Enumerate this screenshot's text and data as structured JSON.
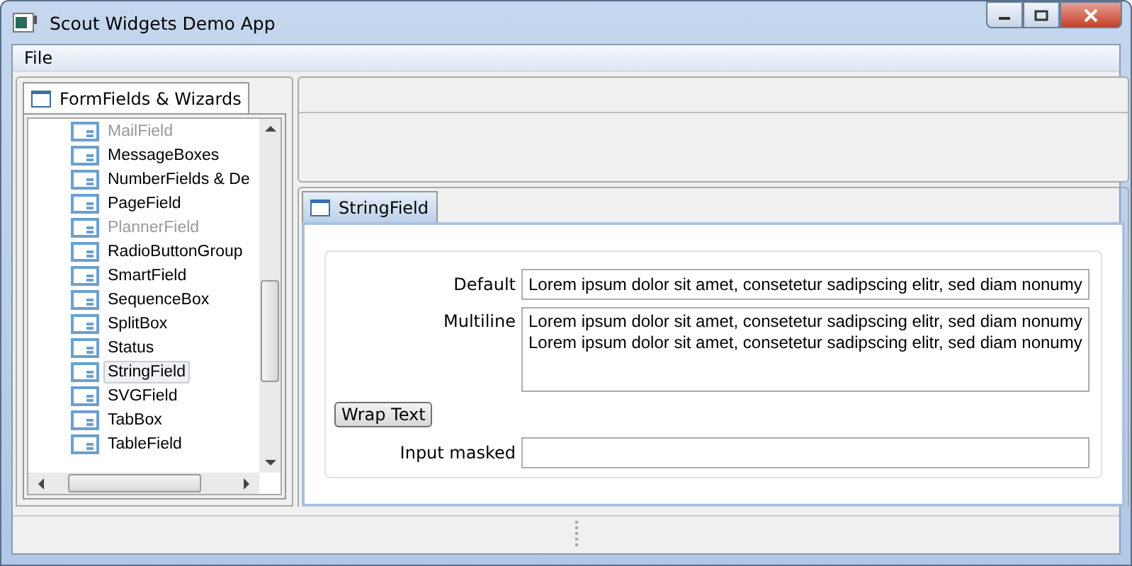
{
  "window": {
    "title": "Scout Widgets Demo App"
  },
  "menu": [
    "File"
  ],
  "left_tab": {
    "label": "FormFields & Wizards",
    "selected": true
  },
  "tree": [
    {
      "label": "MailField",
      "disabled": true,
      "selected": false
    },
    {
      "label": "MessageBoxes",
      "disabled": false,
      "selected": false
    },
    {
      "label": "NumberFields & De",
      "disabled": false,
      "selected": false
    },
    {
      "label": "PageField",
      "disabled": false,
      "selected": false
    },
    {
      "label": "PlannerField",
      "disabled": true,
      "selected": false
    },
    {
      "label": "RadioButtonGroup",
      "disabled": false,
      "selected": false
    },
    {
      "label": "SmartField",
      "disabled": false,
      "selected": false
    },
    {
      "label": "SequenceBox",
      "disabled": false,
      "selected": false
    },
    {
      "label": "SplitBox",
      "disabled": false,
      "selected": false
    },
    {
      "label": "Status",
      "disabled": false,
      "selected": false
    },
    {
      "label": "StringField",
      "disabled": false,
      "selected": true
    },
    {
      "label": "SVGField",
      "disabled": false,
      "selected": false
    },
    {
      "label": "TabBox",
      "disabled": false,
      "selected": false
    },
    {
      "label": "TableField",
      "disabled": false,
      "selected": false
    }
  ],
  "form_tab": {
    "label": "StringField",
    "selected": true
  },
  "fields": [
    {
      "kind": "text",
      "label": "Default",
      "value": "Lorem ipsum dolor sit amet, consetetur sadipscing elitr, sed diam nonumy"
    },
    {
      "kind": "multiline",
      "label": "Multiline",
      "lines": [
        "Lorem ipsum dolor sit amet, consetetur sadipscing elitr, sed diam nonumy",
        "Lorem ipsum dolor sit amet, consetetur sadipscing elitr, sed diam nonumy"
      ]
    },
    {
      "kind": "button",
      "label": "Wrap Text"
    },
    {
      "kind": "text",
      "label": "Input masked"
    }
  ]
}
